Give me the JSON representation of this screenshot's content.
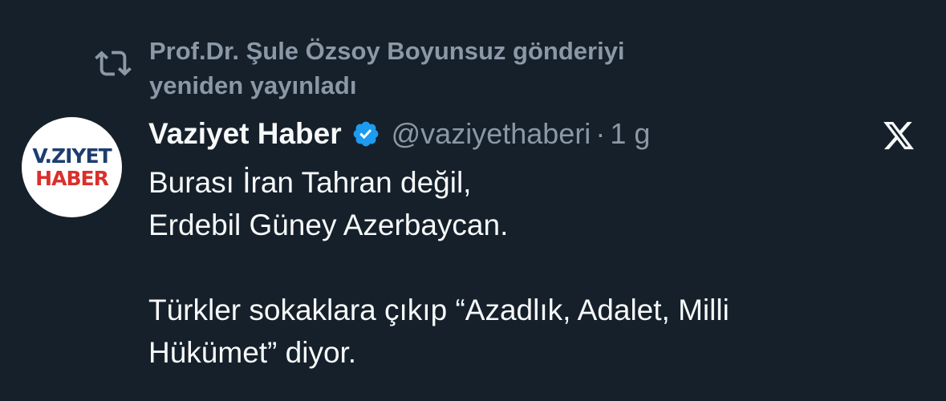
{
  "repost": {
    "line1": "Prof.Dr. Şule Özsoy Boyunsuz gönderiyi",
    "line2": "yeniden yayınladı"
  },
  "author": {
    "avatar_line1": "V.ZIYET",
    "avatar_line2": "HABER",
    "name": "Vaziyet Haber",
    "handle": "@vaziyethaberi",
    "separator": "·",
    "time": "1 g"
  },
  "tweet": {
    "lines": [
      "Burası İran Tahran değil,",
      "Erdebil Güney Azerbaycan.",
      "",
      "Türkler sokaklara çıkıp “Azadlık, Adalet, Milli",
      "Hükümet” diyor."
    ]
  },
  "icons": {
    "repost": "repost-icon",
    "verified": "verified-badge-icon",
    "x_logo": "x-logo-icon"
  },
  "colors": {
    "background": "#15202b",
    "primary_text": "#f7f9f9",
    "secondary_text": "#8b98a5",
    "verified_blue": "#1d9bf0",
    "avatar_blue": "#1d3d6f",
    "avatar_red": "#d9302c"
  }
}
